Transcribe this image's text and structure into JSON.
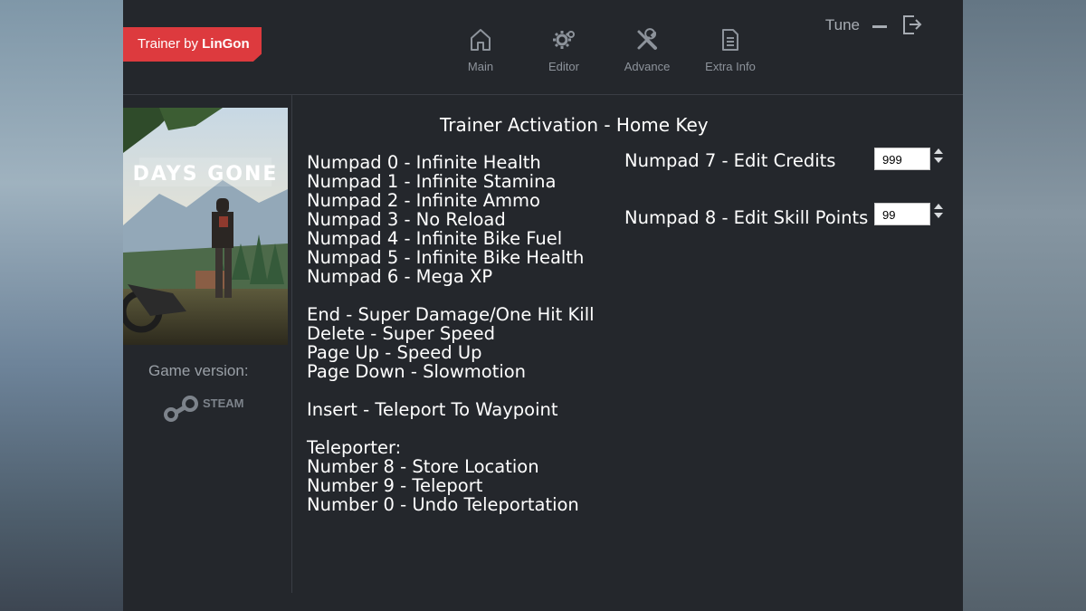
{
  "brand": {
    "prefix": "Trainer by ",
    "name": "LinGon"
  },
  "nav": [
    {
      "label": "Main",
      "icon": "home-icon"
    },
    {
      "label": "Editor",
      "icon": "gear-icon"
    },
    {
      "label": "Advance",
      "icon": "tools-icon"
    },
    {
      "label": "Extra Info",
      "icon": "document-icon"
    }
  ],
  "window_controls": {
    "tune_label": "Tune"
  },
  "cover": {
    "title": "DAYS GONE"
  },
  "game_version_label": "Game version:",
  "platform": {
    "name": "STEAM"
  },
  "activation": "Trainer Activation - Home Key",
  "hotkeys": {
    "group1": [
      "Numpad 0 - Infinite Health",
      "Numpad 1 - Infinite Stamina",
      "Numpad 2 - Infinite Ammo",
      "Numpad 3 - No Reload",
      "Numpad 4 - Infinite Bike Fuel",
      "Numpad 5 - Infinite Bike Health",
      "Numpad 6 - Mega XP"
    ],
    "group2": [
      "End - Super Damage/One Hit Kill",
      "Delete - Super Speed",
      "Page Up - Speed Up",
      "Page Down - Slowmotion"
    ],
    "group3": [
      "Insert - Teleport To Waypoint"
    ],
    "group4": [
      "Teleporter:",
      "Number 8 - Store Location",
      "Number 9 - Teleport",
      "Number 0 - Undo Teleportation"
    ]
  },
  "editor": {
    "credits": {
      "label": "Numpad 7 - Edit Credits",
      "value": "999"
    },
    "skill_points": {
      "label": "Numpad 8 - Edit Skill Points",
      "value": "99"
    }
  },
  "colors": {
    "window_bg": "#24272c",
    "brand_red": "#dd3a3e",
    "nav_gray": "#8d939b"
  }
}
